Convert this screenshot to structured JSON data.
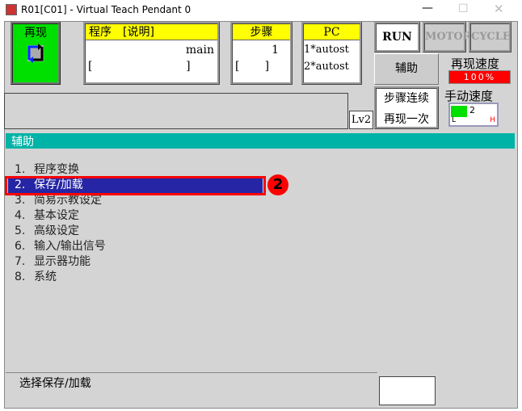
{
  "window": {
    "title": "R01[C01] - Virtual Teach Pendant 0"
  },
  "mode": {
    "label": "再现",
    "icon": "cycle-arrows-icon"
  },
  "program": {
    "header": "程序　[说明]",
    "name": "main",
    "comment": "[                          ]"
  },
  "step": {
    "header": "步骤",
    "value": "1",
    "comment": "[       ]"
  },
  "pc": {
    "header": "PC",
    "line1": "1*autost",
    "line2": "2*autost"
  },
  "status": {
    "run": "RUN",
    "motor": "MOTOR",
    "cycle": "CYCLE"
  },
  "aux_button": "辅助",
  "replay_speed": {
    "label": "再现速度",
    "value": "100%"
  },
  "step_mode": {
    "line1": "步骤连续",
    "line2": "再现一次"
  },
  "level": "Lv2",
  "manual_speed": {
    "label": "手动速度",
    "value": "2",
    "low": "L",
    "high": "H"
  },
  "panel": {
    "title": "辅助"
  },
  "menu": [
    {
      "num": "1.",
      "label": "程序变换"
    },
    {
      "num": "2.",
      "label": "保存/加载"
    },
    {
      "num": "3.",
      "label": "简易示教设定"
    },
    {
      "num": "4.",
      "label": "基本设定"
    },
    {
      "num": "5.",
      "label": "高级设定"
    },
    {
      "num": "6.",
      "label": "输入/输出信号"
    },
    {
      "num": "7.",
      "label": "显示器功能"
    },
    {
      "num": "8.",
      "label": "系统"
    }
  ],
  "selected_index": 1,
  "annotation": "2",
  "status_message": "选择保存/加载",
  "colors": {
    "teal": "#00b3a7",
    "selected": "#2525a5",
    "green": "#00e000",
    "yellow": "#ffff00",
    "red": "#ff0000"
  }
}
